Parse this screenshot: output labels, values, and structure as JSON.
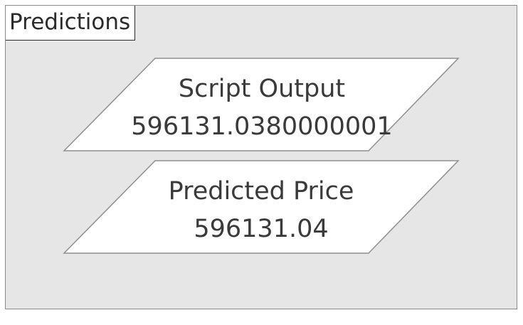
{
  "group": {
    "title": "Predictions"
  },
  "nodes": [
    {
      "label": "Script Output",
      "value": "596131.0380000001"
    },
    {
      "label": "Predicted Price",
      "value": "596131.04"
    }
  ]
}
